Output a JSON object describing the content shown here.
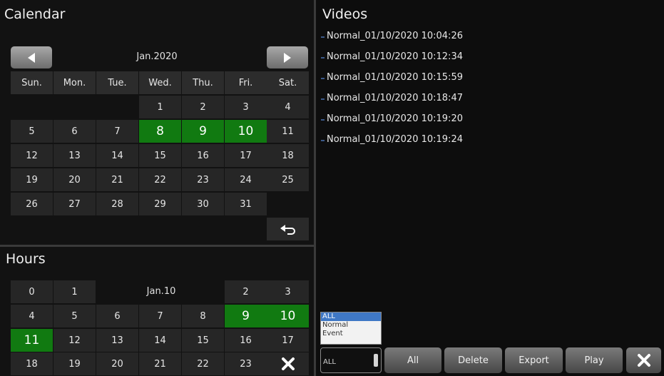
{
  "calendar": {
    "title": "Calendar",
    "month_label": "Jan.2020",
    "prev_icon": "arrow-left-icon",
    "next_icon": "arrow-right-icon",
    "weekdays": [
      "Sun.",
      "Mon.",
      "Tue.",
      "Wed.",
      "Thu.",
      "Fri.",
      "Sat."
    ],
    "weeks": [
      [
        "",
        "",
        "",
        "1",
        "2",
        "3",
        "4"
      ],
      [
        "5",
        "6",
        "7",
        "8",
        "9",
        "10",
        "11"
      ],
      [
        "12",
        "13",
        "14",
        "15",
        "16",
        "17",
        "18"
      ],
      [
        "19",
        "20",
        "21",
        "22",
        "23",
        "24",
        "25"
      ],
      [
        "26",
        "27",
        "28",
        "29",
        "30",
        "31",
        ""
      ]
    ],
    "days_with_video": [
      "8",
      "9",
      "10"
    ],
    "back_icon": "undo-icon"
  },
  "hours": {
    "title": "Hours",
    "date_label": "Jan.10",
    "rows": [
      [
        "0",
        "1",
        "",
        "",
        "",
        "2",
        "3"
      ],
      [
        "4",
        "5",
        "6",
        "7",
        "8",
        "9",
        "10"
      ],
      [
        "11",
        "12",
        "13",
        "14",
        "15",
        "16",
        "17"
      ],
      [
        "18",
        "19",
        "20",
        "21",
        "22",
        "23",
        ""
      ]
    ],
    "hours_with_video": [
      "9",
      "10",
      "11"
    ],
    "close_icon": "close-icon"
  },
  "videos": {
    "title": "Videos",
    "items": [
      "Normal_01/10/2020 10:04:26",
      "Normal_01/10/2020 10:12:34",
      "Normal_01/10/2020 10:15:59",
      "Normal_01/10/2020 10:18:47",
      "Normal_01/10/2020 10:19:20",
      "Normal_01/10/2020 10:19:24"
    ]
  },
  "filter": {
    "options": [
      "ALL",
      "Normal",
      "Event"
    ],
    "selected": "ALL"
  },
  "toolbar": {
    "all_label": "All",
    "delete_label": "Delete",
    "export_label": "Export",
    "play_label": "Play",
    "close_icon": "close-icon"
  },
  "colors": {
    "highlight": "#117a11",
    "selected_option": "#3f78c6"
  }
}
